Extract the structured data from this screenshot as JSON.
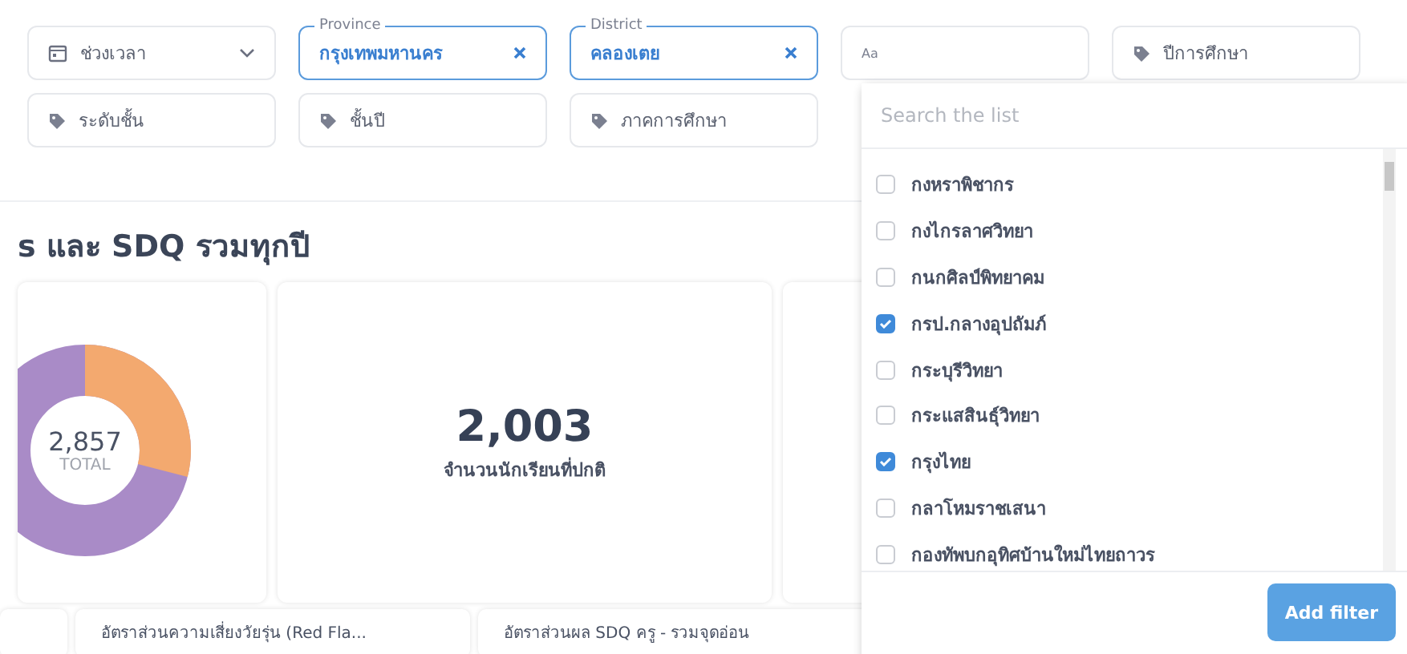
{
  "filters_row1": [
    {
      "kind": "dropdown",
      "label": "ช่วงเวลา",
      "active": false
    },
    {
      "kind": "select",
      "caption": "Province",
      "label": "กรุงเทพมหานคร",
      "active": true
    },
    {
      "kind": "select",
      "caption": "District",
      "label": "คลองเตย",
      "active": true
    },
    {
      "kind": "text",
      "label": "Aa",
      "active": false
    },
    {
      "kind": "tag",
      "label": "ปีการศึกษา",
      "active": false
    }
  ],
  "filters_row2": [
    {
      "kind": "tag",
      "label": "ระดับชั้น",
      "active": false
    },
    {
      "kind": "tag",
      "label": "ชั้นปี",
      "active": false
    },
    {
      "kind": "tag",
      "label": "ภาคการศึกษา",
      "active": false
    }
  ],
  "section_title": "s และ SDQ รวมทุกปี",
  "donut_card": {
    "total": "2,857",
    "total_label": "TOTAL"
  },
  "stat_card": {
    "value": "2,003",
    "label": "จำนวนนักเรียนที่ปกติ"
  },
  "bottom_cards": [
    "อัตราส่วนความเสี่ยงวัยรุ่น (Red Fla...",
    "อัตราส่วนผล SDQ ครู - รวมจุดอ่อน"
  ],
  "dropdown": {
    "placeholder": "Search the list",
    "options": [
      {
        "label": "กงหราพิชากร",
        "checked": false
      },
      {
        "label": "กงไกรลาศวิทยา",
        "checked": false
      },
      {
        "label": "กนกศิลป์พิทยาคม",
        "checked": false
      },
      {
        "label": "กรป.กลางอุปถัมภ์",
        "checked": true
      },
      {
        "label": "กระบุรีวิทยา",
        "checked": false
      },
      {
        "label": "กระแสสินธุ์วิทยา",
        "checked": false
      },
      {
        "label": "กรุงไทย",
        "checked": true
      },
      {
        "label": "กลาโหมราชเสนา",
        "checked": false
      },
      {
        "label": "กองทัพบกอุทิศบ้านใหม่ไทยถาวร",
        "checked": false
      }
    ],
    "button": "Add filter"
  }
}
